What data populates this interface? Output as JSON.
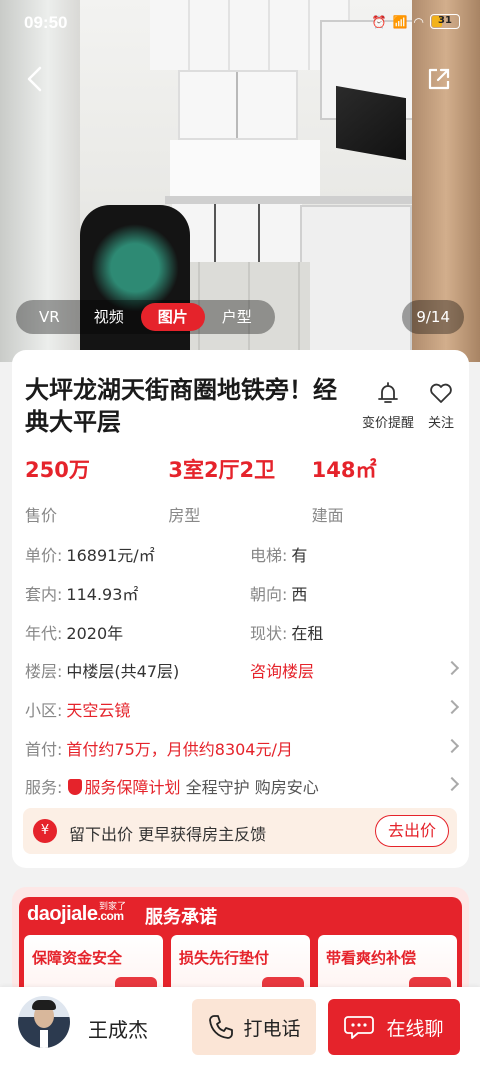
{
  "status_bar": {
    "time": "09:50",
    "battery": "31"
  },
  "gallery": {
    "tabs": [
      "VR",
      "视频",
      "图片",
      "户型"
    ],
    "active_tab": "图片",
    "counter": "9/14"
  },
  "listing": {
    "title": "大坪龙湖天街商圈地铁旁！经典大平层",
    "actions": {
      "price_alert": "变价提醒",
      "follow": "关注"
    },
    "key_stats": [
      {
        "value": "250万",
        "label": "售价"
      },
      {
        "value": "3室2厅2卫",
        "label": "房型"
      },
      {
        "value": "148㎡",
        "label": "建面"
      }
    ],
    "details": {
      "unit_price": {
        "label": "单价:",
        "value": "16891元/㎡"
      },
      "elevator": {
        "label": "电梯:",
        "value": "有"
      },
      "inner_area": {
        "label": "套内:",
        "value": "114.93㎡"
      },
      "orientation": {
        "label": "朝向:",
        "value": "西"
      },
      "year": {
        "label": "年代:",
        "value": "2020年"
      },
      "status": {
        "label": "现状:",
        "value": "在租"
      },
      "floor": {
        "label": "楼层:",
        "value": "中楼层(共47层)",
        "link": "咨询楼层"
      },
      "community": {
        "label": "小区:",
        "value": "天空云镜"
      },
      "down_payment": {
        "label": "首付:",
        "value": "首付约75万，月供约8304元/月"
      },
      "service": {
        "label": "服务:",
        "highlight": "服务保障计划",
        "rest": "全程守护 购房安心"
      }
    },
    "bid_bar": {
      "icon": "¥",
      "text": "留下出价 更早获得房主反馈",
      "button": "去出价"
    }
  },
  "service_promise": {
    "brand": "daojiale",
    "brand_suffix": ".com",
    "brand_tag": "到家了",
    "title": "服务承诺",
    "items": [
      "保障资金安全",
      "损失先行垫付",
      "带看爽约补偿"
    ]
  },
  "bottom_bar": {
    "agent_name": "王成杰",
    "call_label": "打电话",
    "chat_label": "在线聊"
  },
  "colors": {
    "accent": "#e5232b",
    "bid_bg": "#fcefe5",
    "call_bg": "#fbe5d6"
  }
}
